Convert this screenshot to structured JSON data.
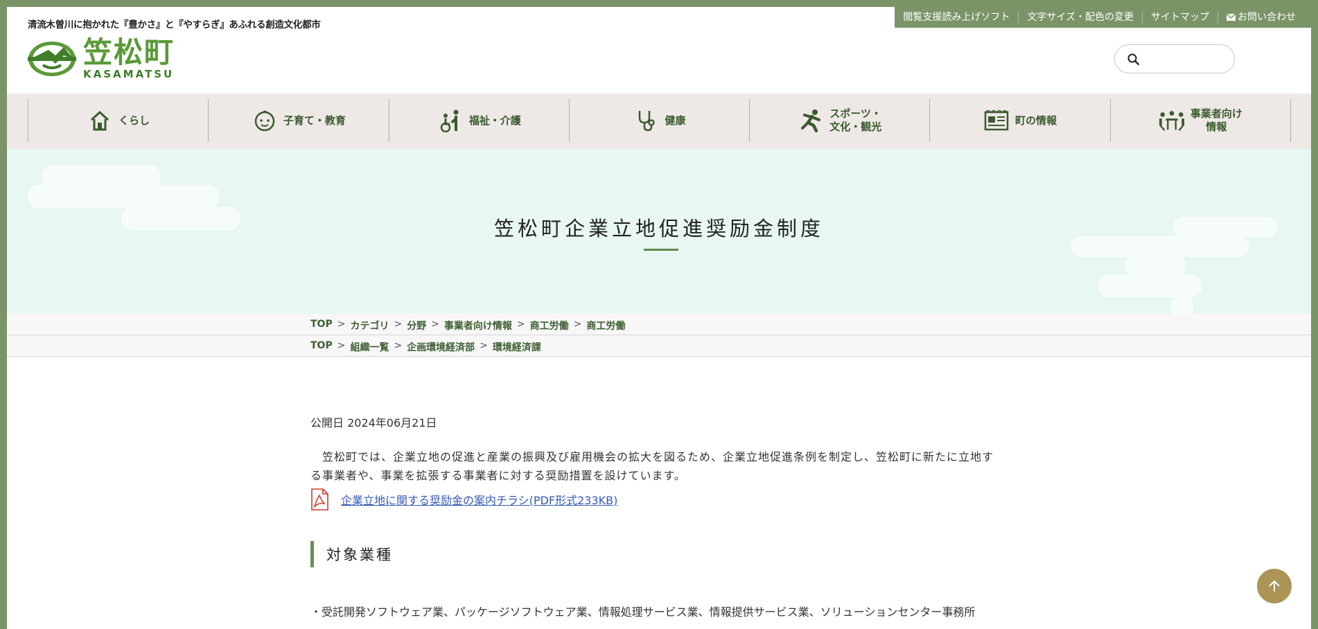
{
  "header": {
    "tagline": "清流木曽川に抱かれた『豊かさ』と『やすらぎ』あふれる創造文化都市",
    "logo_jp": "笠松町",
    "logo_en": "KASAMATSU"
  },
  "util_links": [
    "閲覧支援読み上げソフト",
    "文字サイズ・配色の変更",
    "サイトマップ",
    "お問い合わせ"
  ],
  "search": {
    "placeholder": ""
  },
  "nav": [
    {
      "label": "くらし",
      "icon": "house-icon"
    },
    {
      "label": "子育て・教育",
      "icon": "baby-face-icon"
    },
    {
      "label": "福祉・介護",
      "icon": "caregiver-icon"
    },
    {
      "label": "健康",
      "icon": "stethoscope-icon"
    },
    {
      "label": "スポーツ・\n文化・観光",
      "icon": "runner-icon"
    },
    {
      "label": "町の情報",
      "icon": "newspaper-icon"
    },
    {
      "label": "事業者向け\n情報",
      "icon": "meeting-icon"
    }
  ],
  "hero": {
    "title": "笠松町企業立地促進奨励金制度"
  },
  "breadcrumbs": [
    [
      "TOP",
      "カテゴリ",
      "分野",
      "事業者向け情報",
      "商工労働",
      "商工労働"
    ],
    [
      "TOP",
      "組織一覧",
      "企画環境経済部",
      "環境経済課"
    ]
  ],
  "content": {
    "published": "公開日 2024年06月21日",
    "intro": "笠松町では、企業立地の促進と産業の振興及び雇用機会の拡大を図るため、企業立地促進条例を制定し、笠松町に新たに立地する事業者や、事業を拡張する事業者に対する奨励措置を設けています。",
    "pdf_link": "企業立地に関する奨励金の案内チラシ(PDF形式233KB)",
    "section_heading": "対象業種",
    "bullet": "・受託開発ソフトウェア業、パッケージソフトウェア業、情報処理サービス業、情報提供サービス業、ソリューションセンター事務所"
  },
  "colors": {
    "frame": "#7a9468",
    "brand_green": "#5a9a38",
    "nav_bg": "#eee9e6",
    "hero_bg": "#e8f6f4",
    "link": "#3459b8",
    "totop": "#ab9456"
  }
}
